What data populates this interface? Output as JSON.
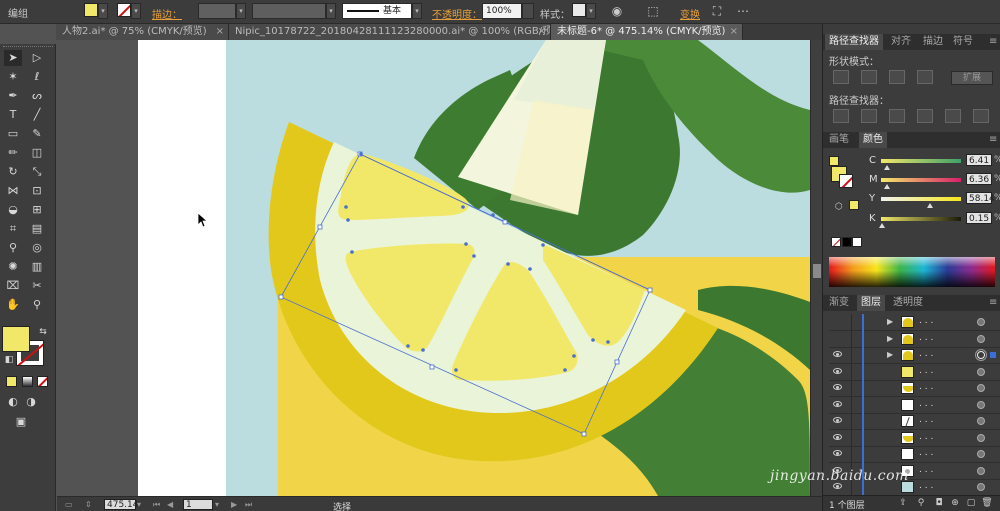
{
  "control_bar": {
    "title": "编组",
    "stroke_label": "描边：",
    "brush_label": "基本",
    "opacity_label": "不透明度：",
    "opacity_value": "100%",
    "style_label": "样式：",
    "transform_label": "变换",
    "fill_color": "#f1e86a"
  },
  "tabs": [
    {
      "label": "人物2.ai* @ 75% (CMYK/预览)"
    },
    {
      "label": "Nipic_10178722_20180428111123280000.ai* @ 100% (RGB/预览)"
    },
    {
      "label": "未标题-6* @ 475.14% (CMYK/预览)"
    }
  ],
  "status_bar": {
    "zoom": "475.14",
    "page": "1",
    "tool_label": "选择"
  },
  "panels": {
    "top_tabs": [
      "路径查找器",
      "对齐",
      "描边",
      "符号"
    ],
    "shape_modes_label": "形状模式：",
    "pathfinder_label": "路径查找器：",
    "expand_label": "扩展",
    "color_tabs": [
      "画笔",
      "颜色"
    ],
    "color": {
      "rows": [
        {
          "label": "C",
          "value": "6.41",
          "unit": "%"
        },
        {
          "label": "M",
          "value": "6.36",
          "unit": "%"
        },
        {
          "label": "Y",
          "value": "58.14",
          "unit": "%"
        },
        {
          "label": "K",
          "value": "0.15",
          "unit": "%"
        }
      ],
      "swatch": "#f1e86a"
    },
    "layer_tabs": [
      "渐变",
      "图层",
      "透明度"
    ],
    "layers": [
      {
        "name": ". . .",
        "thumb": "lemon"
      },
      {
        "name": ". . .",
        "thumb": "lemon"
      },
      {
        "name": ". . .",
        "thumb": "lemon"
      },
      {
        "name": ". . .",
        "thumb": "yellow"
      },
      {
        "name": ". . .",
        "thumb": "slice"
      },
      {
        "name": ". . .",
        "thumb": "white"
      },
      {
        "name": ". . .",
        "thumb": "line"
      },
      {
        "name": ". . .",
        "thumb": "slice"
      },
      {
        "name": ". . .",
        "thumb": "white"
      },
      {
        "name": ". . .",
        "thumb": "dot"
      },
      {
        "name": ". . .",
        "thumb": "blue"
      }
    ],
    "layers_count": "1 个图层"
  },
  "watermark": "jingyan.baidu.com"
}
